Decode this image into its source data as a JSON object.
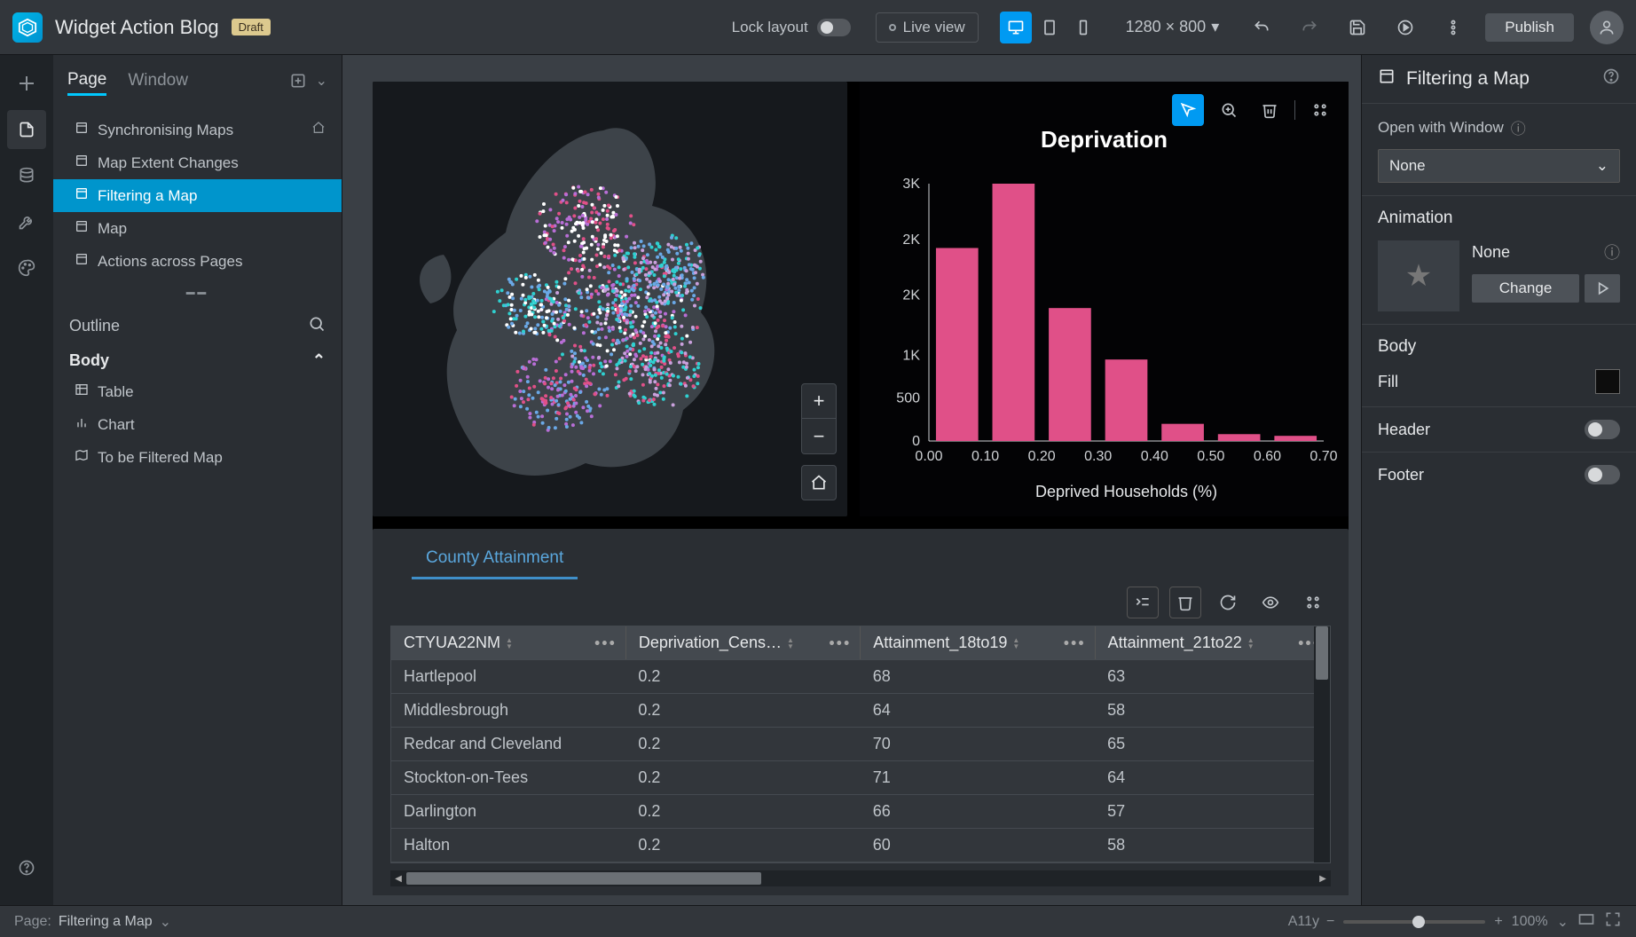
{
  "header": {
    "title": "Widget Action Blog",
    "badge": "Draft",
    "lock_label": "Lock layout",
    "live_view": "Live view",
    "dims": "1280 × 800",
    "publish": "Publish"
  },
  "left": {
    "tabs": {
      "page": "Page",
      "window": "Window"
    },
    "pages": [
      {
        "label": "Synchronising Maps",
        "home": true
      },
      {
        "label": "Map Extent Changes",
        "home": false
      },
      {
        "label": "Filtering a Map",
        "home": false,
        "selected": true
      },
      {
        "label": "Map",
        "home": false
      },
      {
        "label": "Actions across Pages",
        "home": false
      }
    ],
    "outline_label": "Outline",
    "body_label": "Body",
    "outline_items": [
      {
        "icon": "table",
        "label": "Table"
      },
      {
        "icon": "chart",
        "label": "Chart"
      },
      {
        "icon": "map",
        "label": "To be Filtered Map"
      }
    ]
  },
  "chart_data": {
    "type": "bar",
    "title": "Deprivation",
    "xlabel": "Deprived Households (%)",
    "ylabel": "",
    "x_ticks": [
      "0.00",
      "0.10",
      "0.20",
      "0.30",
      "0.40",
      "0.50",
      "0.60",
      "0.70"
    ],
    "y_ticks": [
      "0",
      "500",
      "1K",
      "2K",
      "2K",
      "3K"
    ],
    "y_tick_values": [
      0,
      500,
      1000,
      2000,
      2000,
      3000
    ],
    "ylim": [
      0,
      3000
    ],
    "categories": [
      0.1,
      0.2,
      0.3,
      0.4,
      0.5,
      0.6,
      0.7
    ],
    "values": [
      2250,
      3000,
      1550,
      950,
      200,
      80,
      60
    ],
    "bar_color": "#e05088"
  },
  "table": {
    "tab": "County Attainment",
    "columns": [
      "CTYUA22NM",
      "Deprivation_Cens…",
      "Attainment_18to19",
      "Attainment_21to22"
    ],
    "rows": [
      [
        "Hartlepool",
        "0.2",
        "68",
        "63"
      ],
      [
        "Middlesbrough",
        "0.2",
        "64",
        "58"
      ],
      [
        "Redcar and Cleveland",
        "0.2",
        "70",
        "65"
      ],
      [
        "Stockton-on-Tees",
        "0.2",
        "71",
        "64"
      ],
      [
        "Darlington",
        "0.2",
        "66",
        "57"
      ],
      [
        "Halton",
        "0.2",
        "60",
        "58"
      ]
    ]
  },
  "right": {
    "title": "Filtering a Map",
    "open_with": "Open with Window",
    "open_with_value": "None",
    "animation_label": "Animation",
    "animation_value": "None",
    "change": "Change",
    "body_label": "Body",
    "fill_label": "Fill",
    "header_label": "Header",
    "footer_label": "Footer"
  },
  "footer": {
    "page_prefix": "Page:",
    "page_name": "Filtering a Map",
    "a11y": "A11y",
    "zoom": "100%"
  }
}
